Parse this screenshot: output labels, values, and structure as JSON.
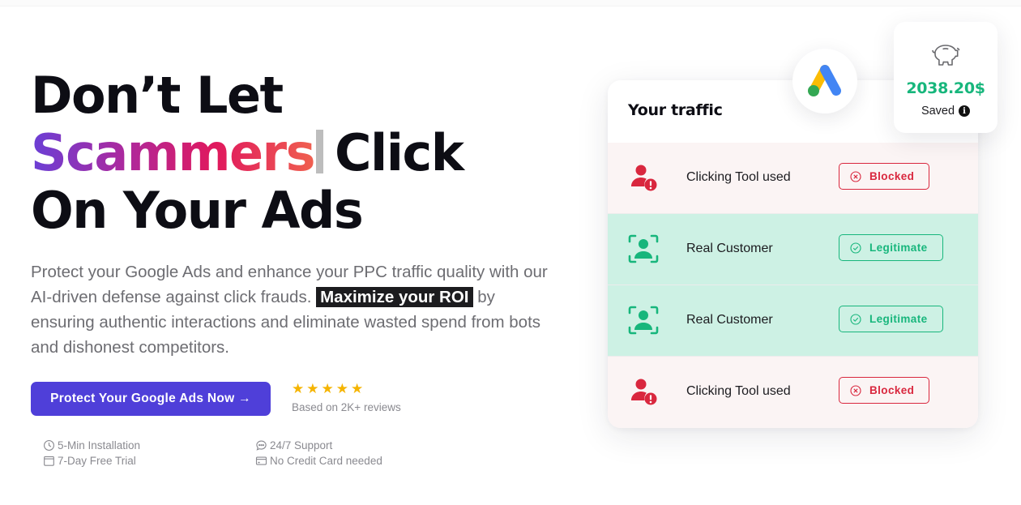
{
  "hero": {
    "title_line1": "Don’t Let",
    "title_highlight": "Scammers",
    "title_after_highlight": "Click",
    "title_line3": "On Your Ads",
    "description_before": "Protect your Google Ads and enhance your PPC traffic quality with our AI-driven defense against click frauds. ",
    "description_highlight": "Maximize your ROI",
    "description_after": " by ensuring authentic interactions and eliminate wasted spend from bots and dishonest competitors.",
    "cta_label": "Protect Your Google Ads Now →",
    "rating": {
      "stars": 5,
      "max_stars": 5,
      "text": "Based on 2K+ reviews"
    },
    "features": [
      {
        "icon": "clock-icon",
        "label": "5-Min Installation"
      },
      {
        "icon": "chat-bubble-icon",
        "label": "24/7 Support"
      },
      {
        "icon": "calendar-icon",
        "label": "7-Day Free Trial"
      },
      {
        "icon": "credit-card-icon",
        "label": "No Credit Card needed"
      }
    ]
  },
  "traffic_card": {
    "title": "Your traffic",
    "rows": [
      {
        "label": "Clicking Tool used",
        "status": "Blocked",
        "type": "blocked",
        "icon": "user-alert-icon"
      },
      {
        "label": "Real Customer",
        "status": "Legitimate",
        "type": "legit",
        "icon": "user-scan-icon"
      },
      {
        "label": "Real Customer",
        "status": "Legitimate",
        "type": "legit",
        "icon": "user-scan-icon"
      },
      {
        "label": "Clicking Tool used",
        "status": "Blocked",
        "type": "blocked",
        "icon": "user-alert-icon"
      }
    ]
  },
  "saved_card": {
    "amount": "2038.20$",
    "label": "Saved",
    "info_glyph": "i"
  },
  "colors": {
    "brand_purple": "#4f3fd9",
    "blocked_red": "#d9273e",
    "legit_green": "#17b67c",
    "star_yellow": "#f5b400"
  }
}
